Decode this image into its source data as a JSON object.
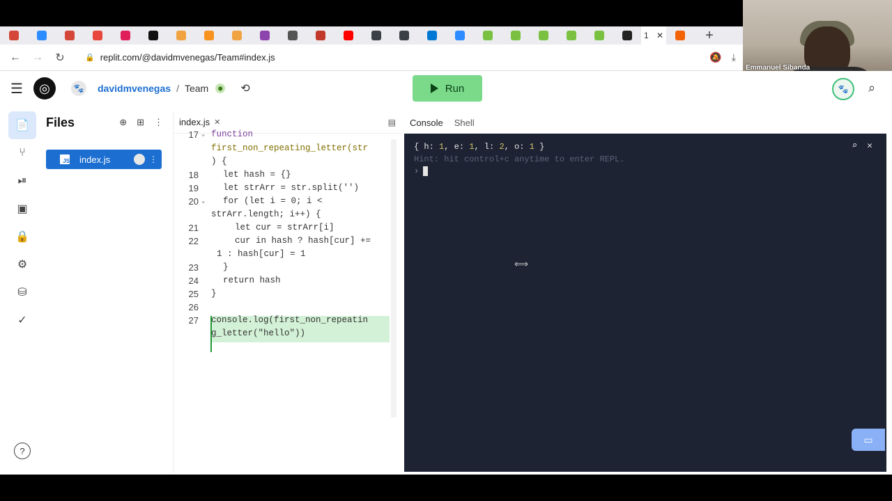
{
  "browser": {
    "active_tab_label": "1",
    "active_tab_close": "✕",
    "new_tab": "+",
    "url": "replit.com/@davidmvenegas/Team#index.js",
    "favicons": [
      "#d44638",
      "#2d8cff",
      "#d44638",
      "#e8453c",
      "#e01e5a",
      "#111111",
      "#f2a341",
      "#f7931e",
      "#f2a341",
      "#8e44ad",
      "#555555",
      "#c0392b",
      "#ff0000",
      "#3b3f46",
      "#3b3f46",
      "#0078d4",
      "#2d8cff",
      "#7ac142",
      "#7ac142",
      "#7ac142",
      "#7ac142",
      "#7ac142",
      "#222222"
    ]
  },
  "webcam": {
    "participant_name": "Emmanuel Sibanda"
  },
  "header": {
    "owner": "davidmvenegas",
    "separator": "/",
    "project": "Team",
    "run_label": "Run"
  },
  "files": {
    "title": "Files",
    "items": [
      {
        "name": "index.js"
      }
    ]
  },
  "editor": {
    "tab_label": "index.js",
    "tab_close": "✕",
    "lines": [
      {
        "n": "17",
        "fold": "⌄"
      },
      {
        "n": "18"
      },
      {
        "n": "19"
      },
      {
        "n": "20",
        "fold": "⌄"
      },
      {
        "n": "21"
      },
      {
        "n": "22"
      },
      {
        "n": "23"
      },
      {
        "n": "24"
      },
      {
        "n": "25"
      },
      {
        "n": "26"
      },
      {
        "n": "27"
      }
    ],
    "code": {
      "l17a": "function",
      "l17b": "first_non_repeating_letter(str",
      "l17c": ") {",
      "l18": "let hash = {}",
      "l19": "let strArr = str.split('')",
      "l20a": "for (let i = 0; i <",
      "l20b": "strArr.length; i++) {",
      "l21": "let cur = strArr[i]",
      "l22a": "cur in hash ? hash[cur] +=",
      "l22b": "1 : hash[cur] = 1",
      "l23": "}",
      "l24": "return hash",
      "l25": "}",
      "l27a": "console.log(first_non_repeatin",
      "l27b": "g_letter(\"hello\"))"
    }
  },
  "console": {
    "tabs": [
      "Console",
      "Shell"
    ],
    "output_line": "{ h: 1, e: 1, l: 2, o: 1 }",
    "hint": "Hint: hit control+c anytime to enter REPL.",
    "prompt": "›"
  }
}
